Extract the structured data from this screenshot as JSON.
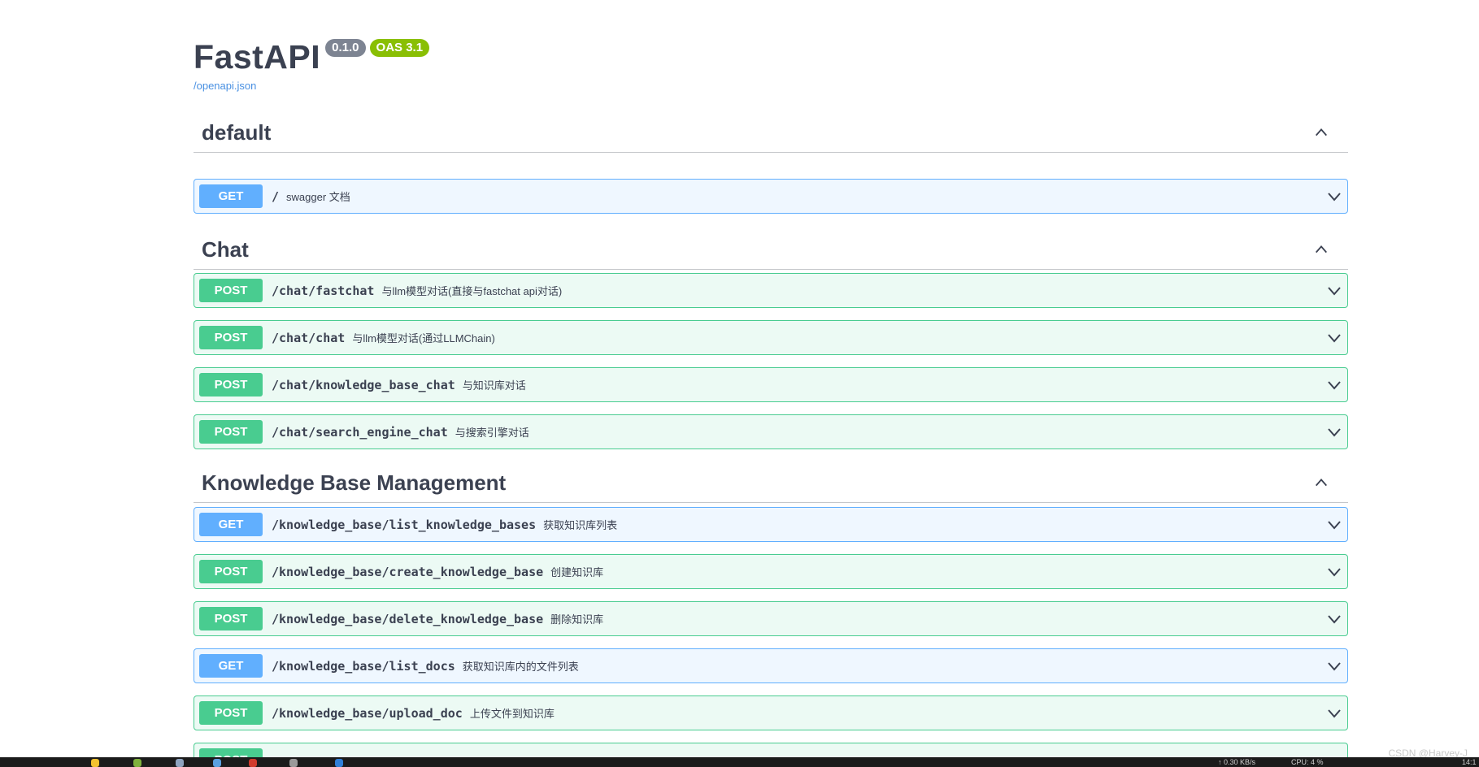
{
  "info": {
    "title": "FastAPI",
    "version_badge": "0.1.0",
    "oas_badge": "OAS 3.1",
    "openapi_link": "/openapi.json"
  },
  "tags": [
    {
      "name": "default",
      "operations": [
        {
          "method": "GET",
          "path": "/",
          "summary": "swagger 文档"
        }
      ]
    },
    {
      "name": "Chat",
      "operations": [
        {
          "method": "POST",
          "path": "/chat/fastchat",
          "summary": "与llm模型对话(直接与fastchat api对话)"
        },
        {
          "method": "POST",
          "path": "/chat/chat",
          "summary": "与llm模型对话(通过LLMChain)"
        },
        {
          "method": "POST",
          "path": "/chat/knowledge_base_chat",
          "summary": "与知识库对话"
        },
        {
          "method": "POST",
          "path": "/chat/search_engine_chat",
          "summary": "与搜索引擎对话"
        }
      ]
    },
    {
      "name": "Knowledge Base Management",
      "operations": [
        {
          "method": "GET",
          "path": "/knowledge_base/list_knowledge_bases",
          "summary": "获取知识库列表"
        },
        {
          "method": "POST",
          "path": "/knowledge_base/create_knowledge_base",
          "summary": "创建知识库"
        },
        {
          "method": "POST",
          "path": "/knowledge_base/delete_knowledge_base",
          "summary": "删除知识库"
        },
        {
          "method": "GET",
          "path": "/knowledge_base/list_docs",
          "summary": "获取知识库内的文件列表"
        },
        {
          "method": "POST",
          "path": "/knowledge_base/upload_doc",
          "summary": "上传文件到知识库"
        },
        {
          "method": "POST",
          "path": "",
          "summary": ""
        }
      ]
    }
  ],
  "icons": {
    "tag_toggle": "chevron-up-icon",
    "operation_toggle": "chevron-down-icon"
  },
  "colors": {
    "get": "#61affe",
    "post": "#49cc90",
    "version_badge": "#7d8492",
    "oas_badge": "#89bf04",
    "link": "#4990e2"
  },
  "taskbar": {
    "network": "↑ 0.30 KB/s",
    "cpu": "CPU: 4 %",
    "clock": "14:1"
  },
  "watermark": "CSDN @Harvey-J"
}
